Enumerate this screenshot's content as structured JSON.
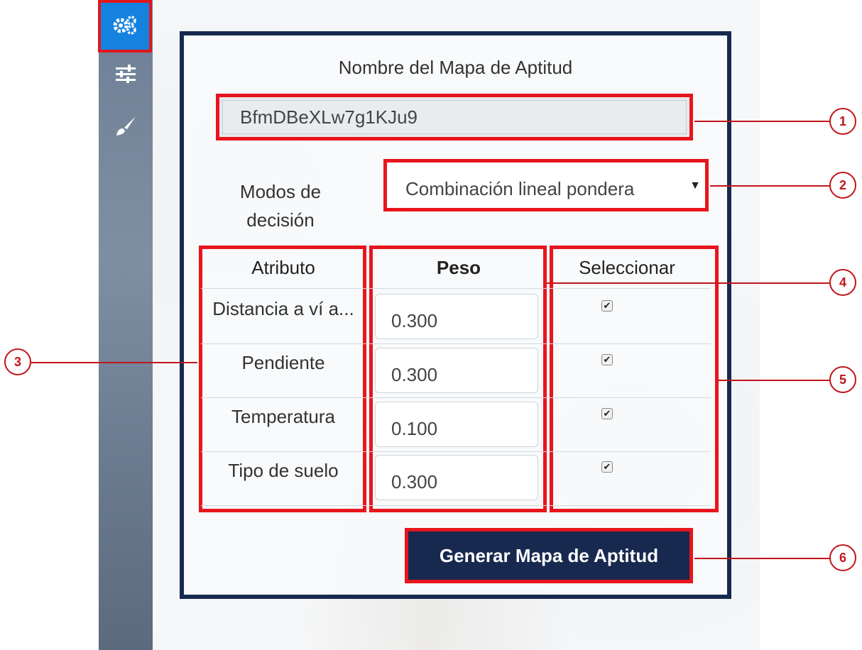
{
  "sidebar": {
    "buttons": [
      {
        "icon": "gears-icon",
        "active": true
      },
      {
        "icon": "sliders-icon",
        "active": false
      },
      {
        "icon": "brush-icon",
        "active": false
      }
    ]
  },
  "form": {
    "title": "Nombre del Mapa de Aptitud",
    "name_value": "BfmDBeXLw7g1KJu9",
    "mode_label": "Modos de decisión",
    "mode_selected": "Combinación lineal pondera",
    "table": {
      "headers": [
        "Atributo",
        "Peso",
        "Seleccionar"
      ],
      "rows": [
        {
          "atributo": "Distancia a ví a...",
          "peso": "0.300",
          "seleccionar": true
        },
        {
          "atributo": "Pendiente",
          "peso": "0.300",
          "seleccionar": true
        },
        {
          "atributo": "Temperatura",
          "peso": "0.100",
          "seleccionar": true
        },
        {
          "atributo": "Tipo de suelo",
          "peso": "0.300",
          "seleccionar": true
        }
      ]
    },
    "generate_label": "Generar Mapa de Aptitud"
  },
  "callouts": [
    "1",
    "2",
    "3",
    "4",
    "5",
    "6"
  ],
  "colors": {
    "highlight": "#e8151d",
    "panel_border": "#17294f",
    "active_tab": "#1582e0"
  }
}
